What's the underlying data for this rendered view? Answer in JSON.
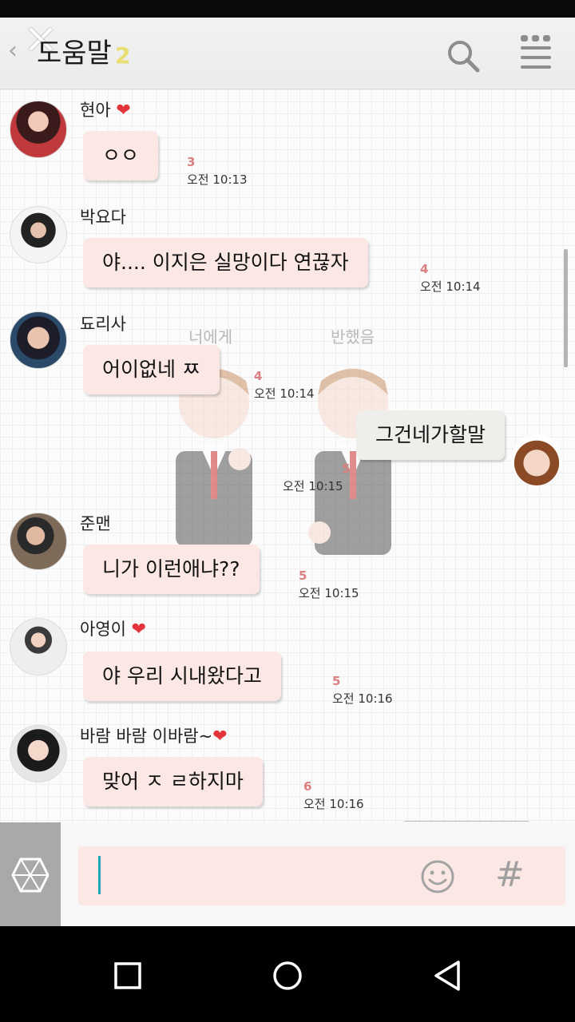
{
  "topbar": {
    "title": "도움말",
    "member_count": "2"
  },
  "watermark": {
    "left_caption": "너에게",
    "right_caption": "반했음"
  },
  "messages": [
    {
      "sender": "현아",
      "heart": "❤",
      "text": "ㅇㅇ",
      "unread": "3",
      "time": "오전 10:13"
    },
    {
      "sender": "박요다",
      "heart": "",
      "text": "야.... 이지은 실망이다 연끊자",
      "unread": "4",
      "time": "오전 10:14"
    },
    {
      "sender": "됴리사",
      "heart": "",
      "text": "어이없네 ㅉ",
      "unread": "4",
      "time": "오전 10:14"
    },
    {
      "sender": "",
      "heart": "",
      "text": "그건네가할말",
      "unread": "5",
      "time": "오전 10:15"
    },
    {
      "sender": "준맨",
      "heart": "",
      "text": "니가 이런애냐??",
      "unread": "5",
      "time": "오전 10:15"
    },
    {
      "sender": "아영이",
      "heart": "❤",
      "text": "야 우리 시내왔다고",
      "unread": "5",
      "time": "오전 10:16"
    },
    {
      "sender": "바람 바람 이바람~",
      "heart": "❤",
      "text": "맞어 ㅈ ㄹ하지마",
      "unread": "6",
      "time": "오전 10:16"
    }
  ],
  "input": {
    "value": "",
    "hash_label": "#"
  },
  "colors": {
    "bubble": "#fbe8e4",
    "my_bubble": "#efeeeb",
    "unread": "#d97f7f",
    "accent_count": "#e8de71",
    "cursor": "#1fa8b5"
  }
}
